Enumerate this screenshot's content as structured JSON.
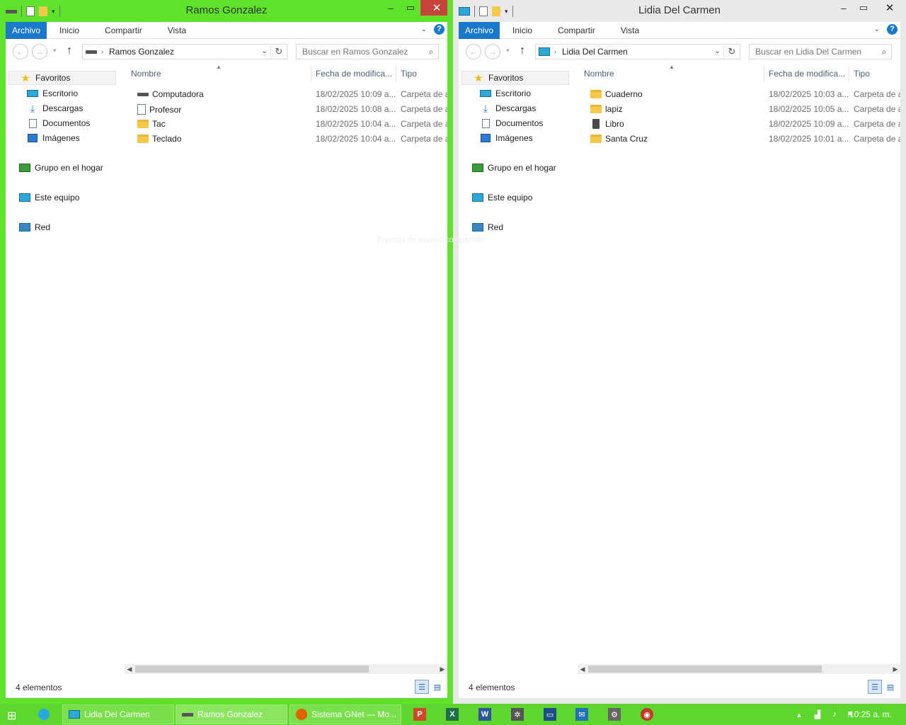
{
  "watermark": "Pantalla de acceso compartido",
  "colors": {
    "accent_active": "#5ee32a",
    "ribbon_file": "#1979ca",
    "taskbar": "#5fd62f"
  },
  "windows": {
    "left": {
      "title": "Ramos Gonzalez",
      "ribbon": {
        "file": "Archivo",
        "tabs": [
          "Inicio",
          "Compartir",
          "Vista"
        ]
      },
      "address": "Ramos Gonzalez",
      "search_placeholder": "Buscar en Ramos Gonzalez",
      "nav": {
        "favorites": "Favoritos",
        "items": [
          "Escritorio",
          "Descargas",
          "Documentos",
          "Imágenes"
        ],
        "homegroup": "Grupo en el hogar",
        "computer": "Este equipo",
        "network": "Red"
      },
      "columns": {
        "name": "Nombre",
        "date": "Fecha de modifica...",
        "type": "Tipo"
      },
      "files": [
        {
          "name": "Computadora",
          "date": "18/02/2025 10:09 a...",
          "type": "Carpeta de a",
          "icon": "drive-icon"
        },
        {
          "name": "Profesor",
          "date": "18/02/2025 10:08 a...",
          "type": "Carpeta de a",
          "icon": "document-icon"
        },
        {
          "name": "Tac",
          "date": "18/02/2025 10:04 a...",
          "type": "Carpeta de a",
          "icon": "folder-icon"
        },
        {
          "name": "Teclado",
          "date": "18/02/2025 10:04 a...",
          "type": "Carpeta de a",
          "icon": "folder-icon"
        }
      ],
      "status": "4 elementos"
    },
    "right": {
      "title": "Lidia Del Carmen",
      "ribbon": {
        "file": "Archivo",
        "tabs": [
          "Inicio",
          "Compartir",
          "Vista"
        ]
      },
      "address": "Lidia Del Carmen",
      "search_placeholder": "Buscar en Lidia Del Carmen",
      "nav": {
        "favorites": "Favoritos",
        "items": [
          "Escritorio",
          "Descargas",
          "Documentos",
          "Imágenes"
        ],
        "homegroup": "Grupo en el hogar",
        "computer": "Este equipo",
        "network": "Red"
      },
      "columns": {
        "name": "Nombre",
        "date": "Fecha de modifica...",
        "type": "Tipo"
      },
      "files": [
        {
          "name": "Cuaderno",
          "date": "18/02/2025 10:03 a...",
          "type": "Carpeta de a",
          "icon": "folder-icon"
        },
        {
          "name": "lapiz",
          "date": "18/02/2025 10:05 a...",
          "type": "Carpeta de a",
          "icon": "folder-icon"
        },
        {
          "name": "Libro",
          "date": "18/02/2025 10:09 a...",
          "type": "Carpeta de a",
          "icon": "book-icon"
        },
        {
          "name": "Santa Cruz",
          "date": "18/02/2025 10:01 a...",
          "type": "Carpeta de a",
          "icon": "folder-icon"
        }
      ],
      "status": "4 elementos"
    }
  },
  "taskbar": {
    "buttons": [
      "Lidia Del Carmen",
      "Ramos Gonzalez",
      "Sistema GNet — Mo..."
    ],
    "pinned_icons": [
      "powerpoint-icon",
      "excel-icon",
      "word-icon",
      "network-game-icon",
      "window-app-icon",
      "outlook-icon",
      "settings-icon",
      "browser-icon"
    ],
    "clock": "10:25 a. m."
  }
}
